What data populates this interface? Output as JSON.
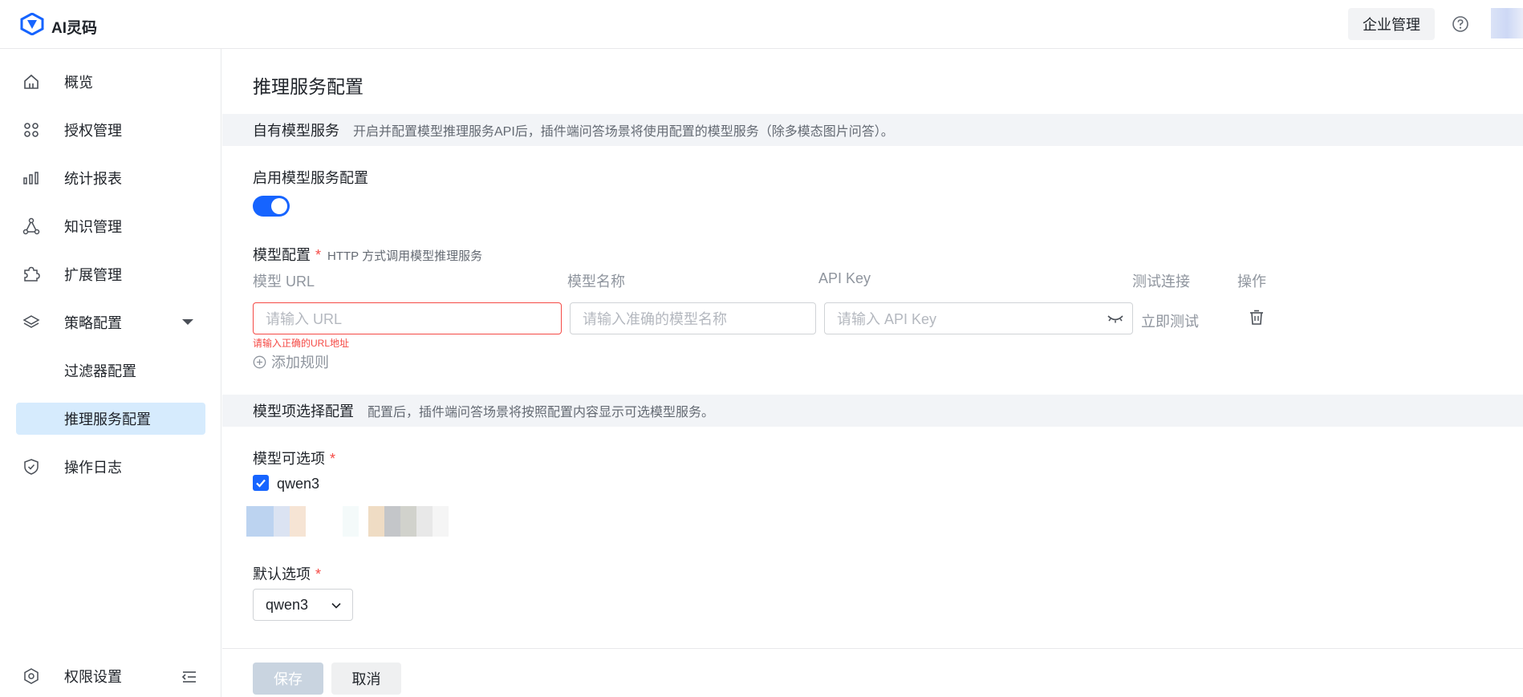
{
  "header": {
    "app_name": "AI灵码",
    "enterprise_button": "企业管理",
    "help_icon": "help-circle-icon"
  },
  "sidebar": {
    "items": [
      {
        "label": "概览",
        "icon": "home-icon"
      },
      {
        "label": "授权管理",
        "icon": "grid-dots-icon"
      },
      {
        "label": "统计报表",
        "icon": "bar-chart-icon"
      },
      {
        "label": "知识管理",
        "icon": "share-nodes-icon"
      },
      {
        "label": "扩展管理",
        "icon": "puzzle-icon"
      },
      {
        "label": "策略配置",
        "icon": "layers-icon"
      },
      {
        "label": "过滤器配置"
      },
      {
        "label": "推理服务配置",
        "active": true
      },
      {
        "label": "操作日志",
        "icon": "shield-check-icon"
      }
    ],
    "bottom": {
      "label": "权限设置",
      "icon": "settings-hex-icon"
    }
  },
  "page": {
    "title": "推理服务配置",
    "own_model": {
      "title": "自有模型服务",
      "desc": "开启并配置模型推理服务API后，插件端问答场景将使用配置的模型服务（除多模态图片问答）。",
      "enable_label": "启用模型服务配置",
      "enabled": true,
      "model_config_label": "模型配置",
      "required_mark": "*",
      "model_config_hint": "HTTP 方式调用模型推理服务",
      "columns": [
        "模型 URL",
        "模型名称",
        "API Key",
        "测试连接",
        "操作"
      ],
      "url_placeholder": "请输入 URL",
      "name_placeholder": "请输入准确的模型名称",
      "key_placeholder": "请输入 API Key",
      "url_error": "请输入正确的URL地址",
      "test_link": "立即测试",
      "add_rule": "添加规则"
    },
    "model_options": {
      "title": "模型项选择配置",
      "desc": "配置后，插件端问答场景将按照配置内容显示可选模型服务。",
      "options_label": "模型可选项",
      "options": [
        {
          "label": "qwen3",
          "checked": true
        }
      ],
      "default_label": "默认选项",
      "default_value": "qwen3",
      "required_mark": "*"
    },
    "footer": {
      "save": "保存",
      "cancel": "取消"
    }
  },
  "colors": {
    "accent": "#1664ff",
    "active_bg": "#d6ebfd",
    "error": "#f54a45",
    "section_bg": "#f2f4f7",
    "save_disabled": "#c9d4e0"
  }
}
